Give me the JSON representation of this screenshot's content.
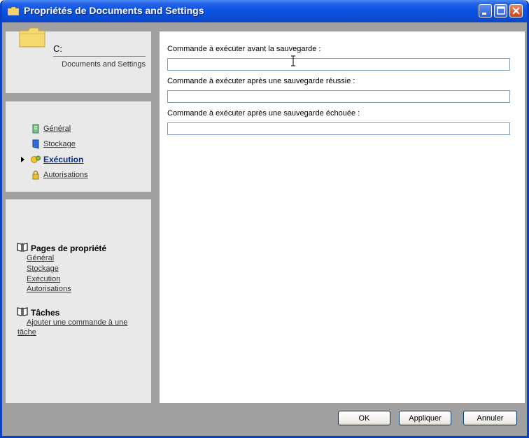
{
  "window": {
    "title": "Propriétés de Documents and Settings",
    "controls": {
      "minimize": "minimize-icon",
      "maximize": "maximize-icon",
      "close": "close-icon"
    }
  },
  "header_panel": {
    "drive": "C:",
    "path": "Documents and Settings",
    "icon": "folder-icon"
  },
  "nav": {
    "items": [
      {
        "label": "Général",
        "icon": "page-icon",
        "active": false
      },
      {
        "label": "Stockage",
        "icon": "storage-icon",
        "active": false
      },
      {
        "label": "Exécution",
        "icon": "execution-gear-icon",
        "active": true
      },
      {
        "label": "Autorisations",
        "icon": "lock-icon",
        "active": false
      }
    ]
  },
  "help_panel": {
    "pages_title": "Pages de propriété",
    "pages_links": [
      "Général",
      "Stockage",
      "Exécution",
      "Autorisations"
    ],
    "tasks_title": "Tâches",
    "task_link_line1": "Ajouter une commande à une",
    "task_link_line2": "tâche"
  },
  "form": {
    "before_label": "Commande à exécuter avant la sauvegarde :",
    "before_value": "",
    "after_success_label": "Commande à exécuter après une sauvegarde réussie :",
    "after_success_value": "",
    "after_fail_label": "Commande à exécuter après une sauvegarde échouée :",
    "after_fail_value": ""
  },
  "buttons": {
    "ok": "OK",
    "apply": "Appliquer",
    "cancel": "Annuler"
  },
  "colors": {
    "titlebar": "#0a4fd9",
    "panel_bg": "#e9e9e9",
    "frame_bg": "#a0a0a0",
    "field_border": "#7f9db9"
  }
}
